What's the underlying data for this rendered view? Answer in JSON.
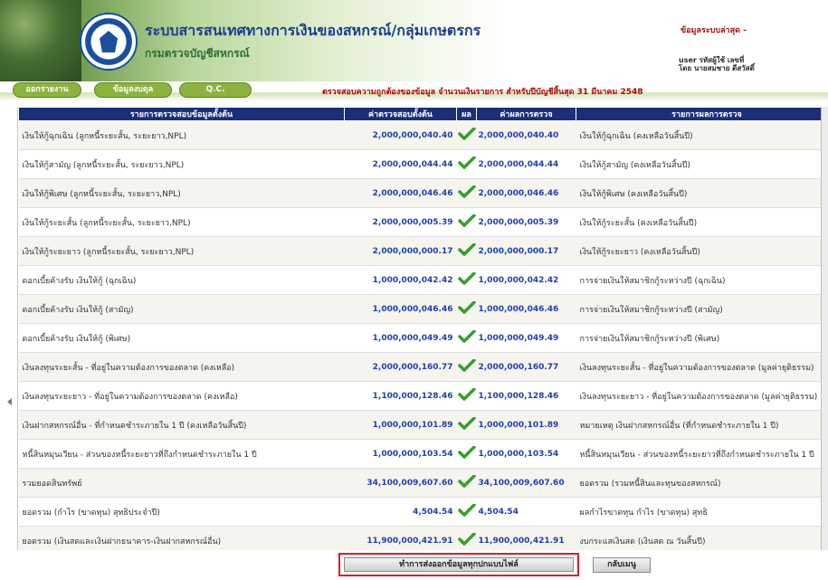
{
  "header": {
    "title": "ระบบสารสนเทศทางการเงินของสหกรณ์/กลุ่มเกษตรกร",
    "subtitle": "กรมตรวจบัญชีสหกรณ์",
    "update_label": "ข้อมูลระบบล่าสุด -",
    "user_label": "user รหัสผู้ใช้ เลขที่",
    "user_name": "โดย นายสมชาย ดีสวัสดิ์"
  },
  "nav": {
    "tabs": [
      "ออกรายงาน",
      "ข้อมูลงบดุล",
      "Q.C."
    ],
    "heading": "ตรวจสอบความถูกต้องของข้อมูล จำนวนเงินรายการ สำหรับปีบัญชีสิ้นสุด 31 มีนาคม 2548"
  },
  "table": {
    "headers": [
      "รายการตรวจสอบข้อมูลตั้งต้น",
      "ค่าตรวจสอบตั้งต้น",
      "ผล",
      "ค่าผลการตรวจ",
      "รายการผลการตรวจ"
    ],
    "rows": [
      {
        "desc": "เงินให้กู้ฉุกเฉิน (ลูกหนี้ระยะสั้น, ระยะยาว,NPL)",
        "val1": "2,000,000,040.40",
        "val2": "2,000,000,040.40",
        "result": "เงินให้กู้ฉุกเฉิน (คงเหลือวันสิ้นปี)"
      },
      {
        "desc": "เงินให้กู้สามัญ (ลูกหนี้ระยะสั้น, ระยะยาว,NPL)",
        "val1": "2,000,000,044.44",
        "val2": "2,000,000,044.44",
        "result": "เงินให้กู้สามัญ (คงเหลือวันสิ้นปี)"
      },
      {
        "desc": "เงินให้กู้พิเศษ (ลูกหนี้ระยะสั้น, ระยะยาว,NPL)",
        "val1": "2,000,000,046.46",
        "val2": "2,000,000,046.46",
        "result": "เงินให้กู้พิเศษ (คงเหลือวันสิ้นปี)"
      },
      {
        "desc": "เงินให้กู้ระยะสั้น (ลูกหนี้ระยะสั้น, ระยะยาว,NPL)",
        "val1": "2,000,000,005.39",
        "val2": "2,000,000,005.39",
        "result": "เงินให้กู้ระยะสั้น (คงเหลือวันสิ้นปี)"
      },
      {
        "desc": "เงินให้กู้ระยะยาว (ลูกหนี้ระยะสั้น, ระยะยาว,NPL)",
        "val1": "2,000,000,000.17",
        "val2": "2,000,000,000.17",
        "result": "เงินให้กู้ระยะยาว (คงเหลือวันสิ้นปี)"
      },
      {
        "desc": "ดอกเบี้ยค้างรับ เงินให้กู้ (ฉุกเฉิน)",
        "val1": "1,000,000,042.42",
        "val2": "1,000,000,042.42",
        "result": "การจ่ายเงินให้สมาชิกกู้ระหว่างปี (ฉุกเฉิน)"
      },
      {
        "desc": "ดอกเบี้ยค้างรับ เงินให้กู้ (สามัญ)",
        "val1": "1,000,000,046.46",
        "val2": "1,000,000,046.46",
        "result": "การจ่ายเงินให้สมาชิกกู้ระหว่างปี (สามัญ)"
      },
      {
        "desc": "ดอกเบี้ยค้างรับ เงินให้กู้ (พิเศษ)",
        "val1": "1,000,000,049.49",
        "val2": "1,000,000,049.49",
        "result": "การจ่ายเงินให้สมาชิกกู้ระหว่างปี (พิเศษ)"
      },
      {
        "desc": "เงินลงทุนระยะสั้น - ที่อยู่ในความต้องการของตลาด (คงเหลือ)",
        "val1": "2,000,000,160.77",
        "val2": "2,000,000,160.77",
        "result": "เงินลงทุนระยะสั้น - ที่อยู่ในความต้องการของตลาด (มูลค่ายุติธรรม)"
      },
      {
        "desc": "เงินลงทุนระยะยาว - ที่อยู่ในความต้องการของตลาด (คงเหลือ)",
        "val1": "1,100,000,128.46",
        "val2": "1,100,000,128.46",
        "result": "เงินลงทุนระยะยาว - ที่อยู่ในความต้องการของตลาด (มูลค่ายุติธรรม)"
      },
      {
        "desc": "เงินฝากสหกรณ์อื่น - ที่กำหนดชำระภายใน 1 ปี (คงเหลือวันสิ้นปี)",
        "val1": "1,000,000,101.89",
        "val2": "1,000,000,101.89",
        "result": "หมายเหตุ เงินฝากสหกรณ์อื่น (ที่กำหนดชำระภายใน 1 ปี)"
      },
      {
        "desc": "หนี้สินหมุนเวียน - ส่วนของหนี้ระยะยาวที่ถึงกำหนดชำระภายใน 1 ปี",
        "val1": "1,000,000,103.54",
        "val2": "1,000,000,103.54",
        "result": "หนี้สินหมุนเวียน - ส่วนของหนี้ระยะยาวที่ถึงกำหนดชำระภายใน 1 ปี"
      },
      {
        "desc": "รวมยอดสินทรัพย์",
        "val1": "34,100,009,607.60",
        "val2": "34,100,009,607.60",
        "result": "ยอดรวม (รวมหนี้สินและทุนของสหกรณ์)"
      },
      {
        "desc": "ยอดรวม (กำไร (ขาดทุน) สุทธิประจำปี)",
        "val1": "4,504.54",
        "val2": "4,504.54",
        "result": "ผลกำไรขาดทุน กำไร (ขาดทุน) สุทธิ"
      },
      {
        "desc": "ยอดรวม (เงินสดและเงินฝากธนาคาร-เงินฝากสหกรณ์อื่น)",
        "val1": "11,900,000,421.91",
        "val2": "11,900,000,421.91",
        "result": "งบกระแสเงินสด (เงินสด ณ วันสิ้นปี)"
      }
    ]
  },
  "buttons": {
    "send_label": "ทำการส่งออกข้อมูลทุกปกแบบไฟล์",
    "back_label": "กลับเมนู"
  },
  "colors": {
    "header_blue": "#1a2f78",
    "value_blue": "#1f3fb0",
    "check_green": "#33a02c",
    "nav_green": "#8cb33f",
    "highlight_red": "#e3172b"
  }
}
